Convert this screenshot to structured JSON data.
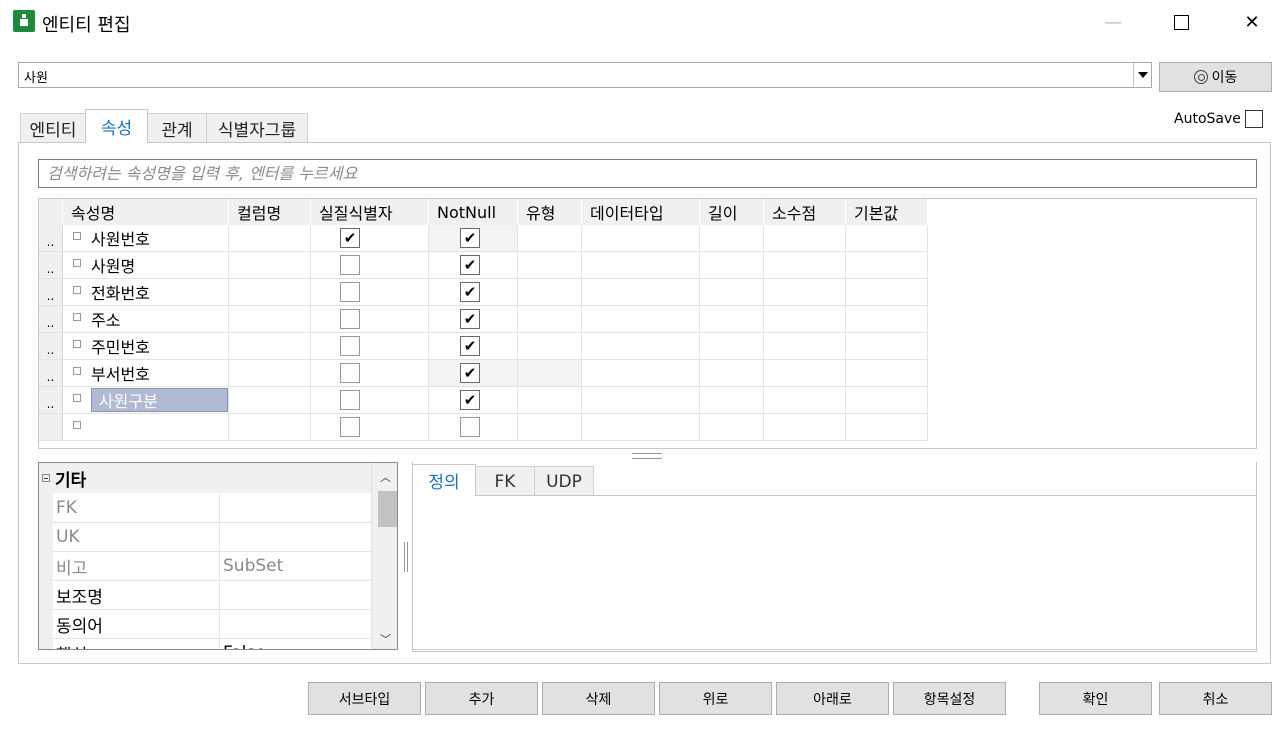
{
  "window": {
    "title": "엔티티 편집",
    "minimize_glyph": "—",
    "close_glyph": "✕"
  },
  "entity_select": {
    "value": "사원"
  },
  "move_button": {
    "label": "이동",
    "icon": "target-icon"
  },
  "autosave": {
    "label": "AutoSave",
    "checked": false
  },
  "tabs": [
    {
      "label": "엔티티",
      "active": false
    },
    {
      "label": "속성",
      "active": true
    },
    {
      "label": "관계",
      "active": false
    },
    {
      "label": "식별자그룹",
      "active": false
    }
  ],
  "search": {
    "placeholder": "검색하려는 속성명을 입력 후, 엔터를 누르세요"
  },
  "grid": {
    "columns": [
      "속성명",
      "컬럼명",
      "실질식별자",
      "NotNull",
      "유형",
      "데이터타입",
      "길이",
      "소수점",
      "기본값"
    ],
    "row_marker": "..",
    "rows": [
      {
        "name": "사원번호",
        "column": "",
        "pk": true,
        "notnull": true,
        "selected": false
      },
      {
        "name": "사원명",
        "column": "",
        "pk": false,
        "notnull": true,
        "selected": false
      },
      {
        "name": "전화번호",
        "column": "",
        "pk": false,
        "notnull": true,
        "selected": false
      },
      {
        "name": "주소",
        "column": "",
        "pk": false,
        "notnull": true,
        "selected": false
      },
      {
        "name": "주민번호",
        "column": "",
        "pk": false,
        "notnull": true,
        "selected": false
      },
      {
        "name": "부서번호",
        "column": "",
        "pk": false,
        "notnull": true,
        "selected": false
      },
      {
        "name": "사원구분",
        "column": "",
        "pk": false,
        "notnull": true,
        "selected": true
      },
      {
        "name": "",
        "column": "",
        "pk": false,
        "notnull": false,
        "selected": false
      }
    ],
    "check_mark": "✔"
  },
  "properties": {
    "category": "기타",
    "rows": [
      {
        "key": "FK",
        "value": "",
        "dim": true
      },
      {
        "key": "UK",
        "value": "",
        "dim": true
      },
      {
        "key": "비고",
        "value": "SubSet",
        "dim": true
      },
      {
        "key": "보조명",
        "value": "",
        "dim": false
      },
      {
        "key": "동의어",
        "value": "",
        "dim": false
      },
      {
        "key": "핵심",
        "value": "False",
        "dim": false
      }
    ]
  },
  "detail_tabs": [
    {
      "label": "정의",
      "active": true
    },
    {
      "label": "FK",
      "active": false
    },
    {
      "label": "UDP",
      "active": false
    }
  ],
  "buttons": {
    "subtype": "서브타입",
    "add": "추가",
    "delete": "삭제",
    "up": "위로",
    "down": "아래로",
    "item_settings": "항목설정",
    "ok": "확인",
    "cancel": "취소"
  }
}
